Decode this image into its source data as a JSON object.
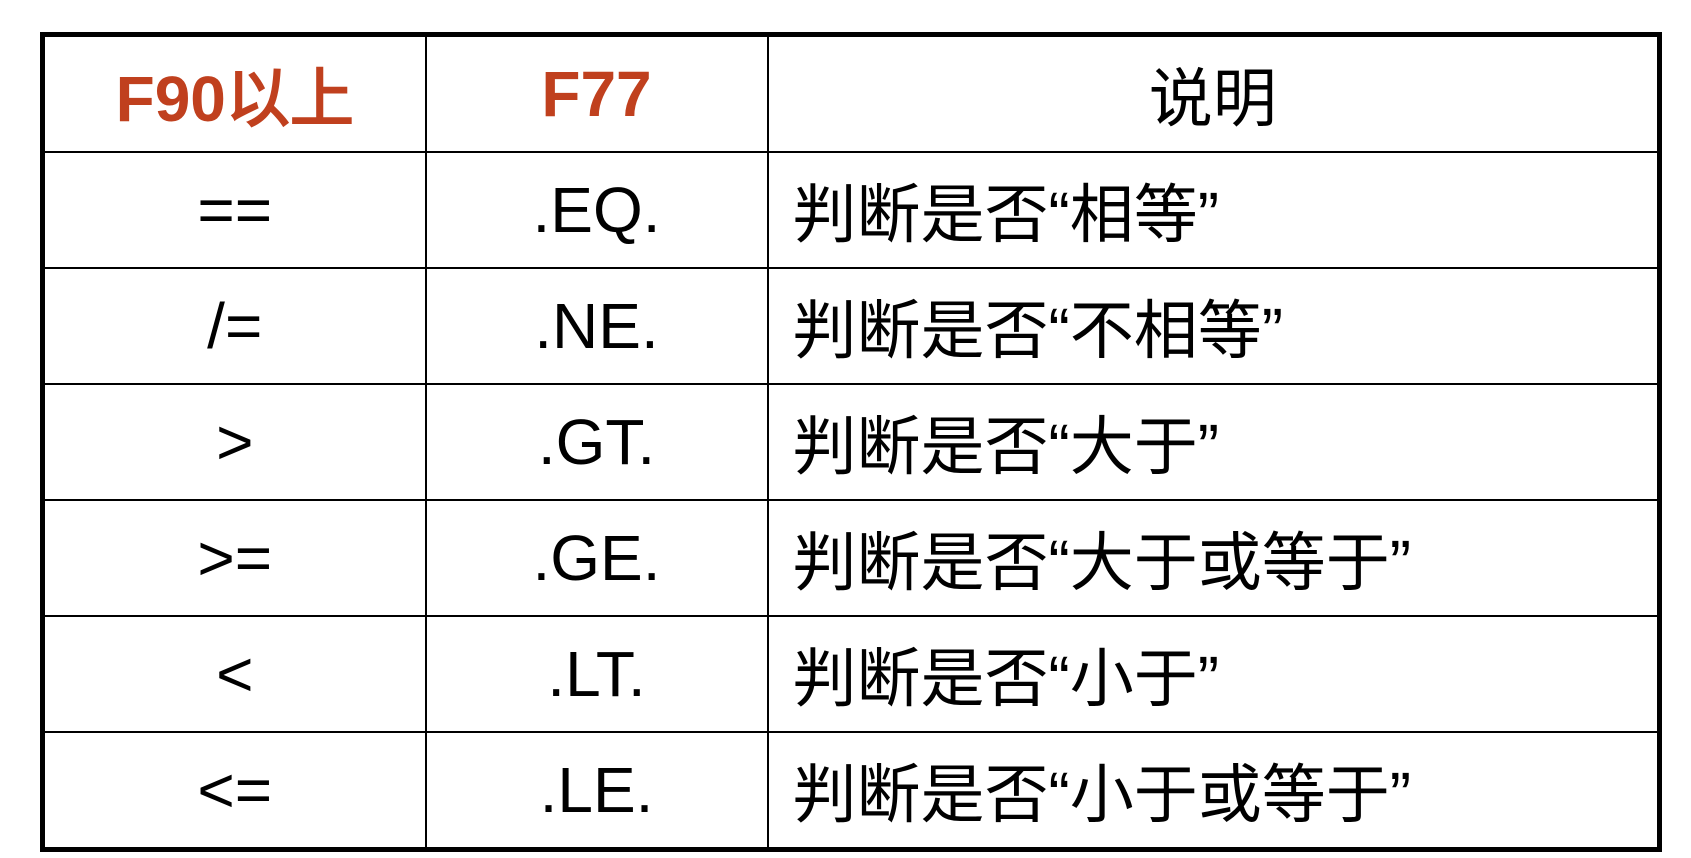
{
  "header": {
    "f90": "F90以上",
    "f77": "F77",
    "desc": "说明"
  },
  "colors": {
    "header_accent": "#c0401e"
  },
  "rows": [
    {
      "f90": "==",
      "f77": ".EQ.",
      "desc": "判断是否“相等”"
    },
    {
      "f90": "/=",
      "f77": ".NE.",
      "desc": "判断是否“不相等”"
    },
    {
      "f90": ">",
      "f77": ".GT.",
      "desc": "判断是否“大于”"
    },
    {
      "f90": ">=",
      "f77": ".GE.",
      "desc": "判断是否“大于或等于”"
    },
    {
      "f90": "<",
      "f77": ".LT.",
      "desc": "判断是否“小于”"
    },
    {
      "f90": "<=",
      "f77": ".LE.",
      "desc": "判断是否“小于或等于”"
    }
  ]
}
